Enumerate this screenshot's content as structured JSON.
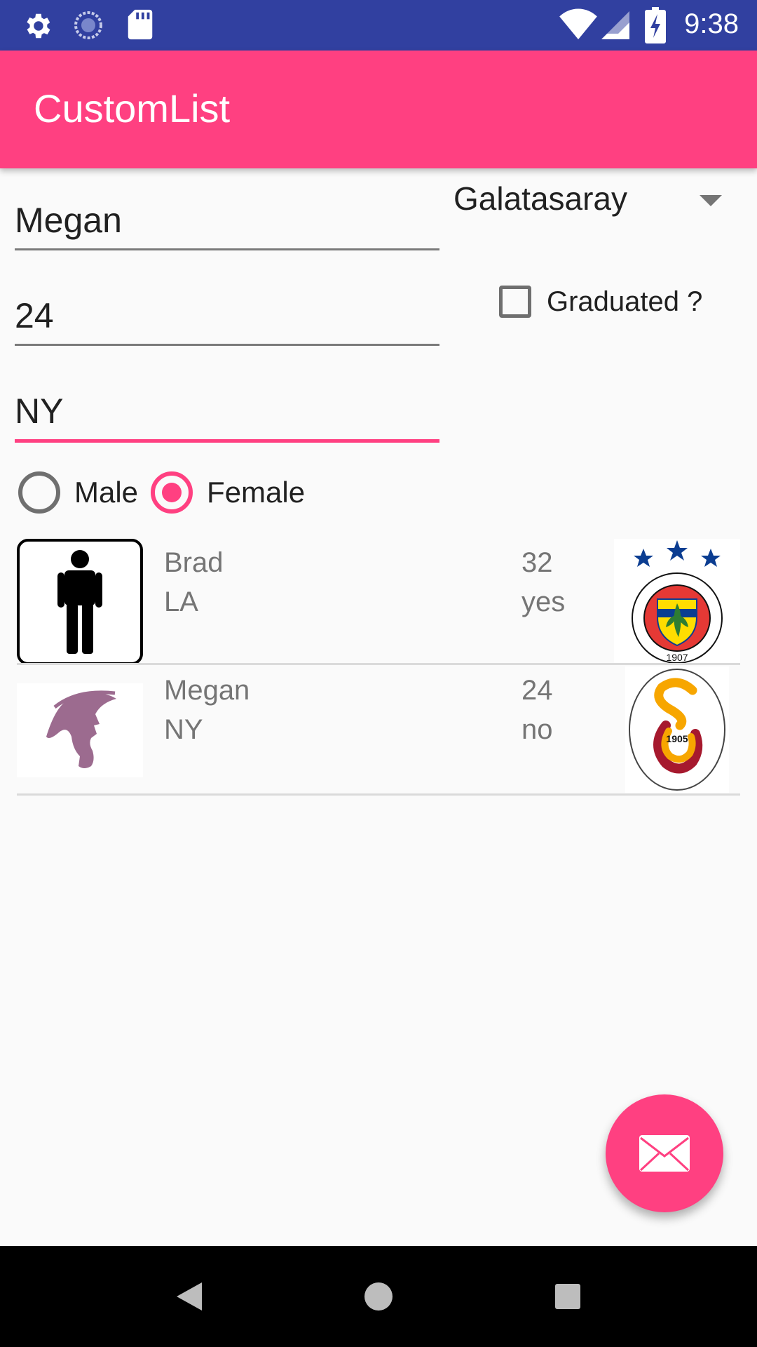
{
  "status_bar": {
    "time": "9:38",
    "icons": [
      "gear-icon",
      "sync-circle-icon",
      "sd-card-icon",
      "wifi-icon",
      "signal-icon",
      "battery-charging-icon"
    ]
  },
  "app_bar": {
    "title": "CustomList"
  },
  "form": {
    "name_value": "Megan",
    "age_value": "24",
    "city_value": "NY",
    "team_selected": "Galatasaray",
    "graduated_label": "Graduated ?",
    "graduated_checked": false,
    "gender_options": [
      "Male",
      "Female"
    ],
    "gender_selected": "Female"
  },
  "list": {
    "items": [
      {
        "name": "Brad",
        "city": "LA",
        "age": "32",
        "graduated": "yes",
        "avatar": "male-person-icon",
        "team_logo": "fenerbahce-logo"
      },
      {
        "name": "Megan",
        "city": "NY",
        "age": "24",
        "graduated": "no",
        "avatar": "female-silhouette-icon",
        "team_logo": "galatasaray-logo"
      }
    ]
  },
  "logos": {
    "fenerbahce_text": "FENERBAHÇE SPOR KULÜBÜ",
    "fenerbahce_year": "1907",
    "galatasaray_year": "1905"
  },
  "fab": {
    "icon": "mail-icon"
  },
  "nav_bar": {
    "buttons": [
      "back-icon",
      "home-icon",
      "recents-icon"
    ]
  },
  "colors": {
    "status_bar": "#3140a0",
    "accent": "#ff4081",
    "background": "#fafafa",
    "secondary_text": "#757575"
  }
}
